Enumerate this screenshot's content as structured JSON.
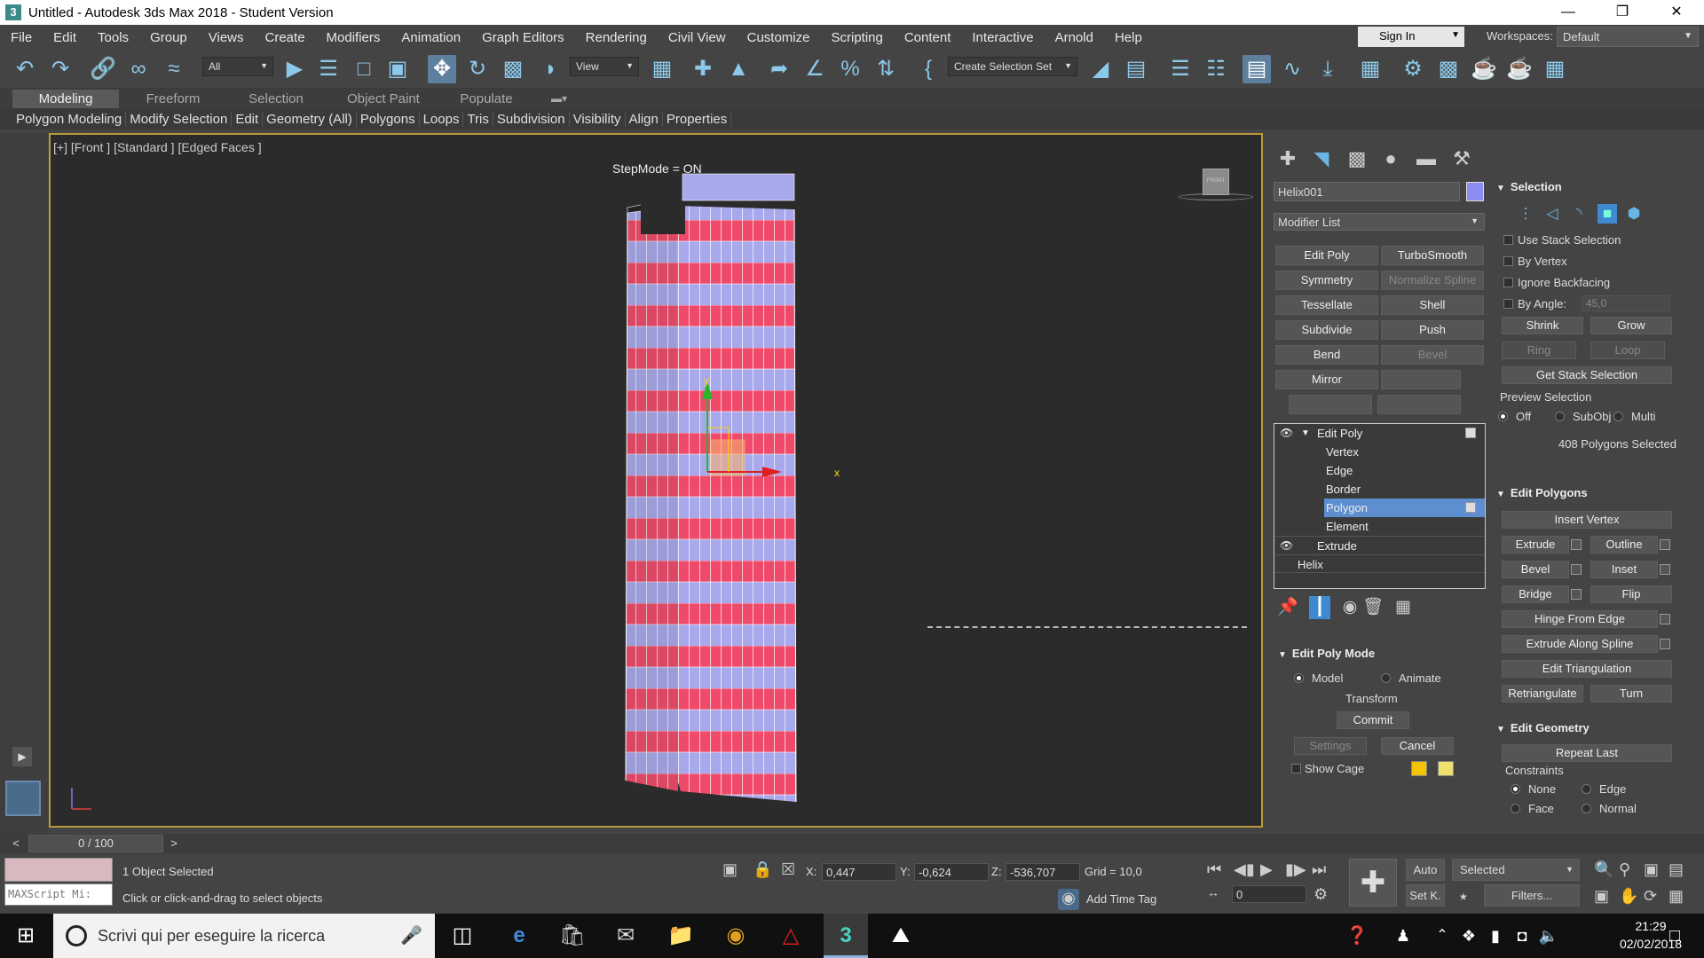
{
  "window": {
    "title": "Untitled - Autodesk 3ds Max 2018 - Student Version",
    "app_icon": "3"
  },
  "menu": [
    "File",
    "Edit",
    "Tools",
    "Group",
    "Views",
    "Create",
    "Modifiers",
    "Animation",
    "Graph Editors",
    "Rendering",
    "Civil View",
    "Customize",
    "Scripting",
    "Content",
    "Interactive",
    "Arnold",
    "Help"
  ],
  "account": {
    "signin": "Sign In",
    "workspaces_label": "Workspaces:",
    "workspace": "Default"
  },
  "toolbar": {
    "filter": "All",
    "refcoord": "View",
    "selection_set": "Create Selection Set"
  },
  "ribbon": {
    "tabs": [
      "Modeling",
      "Freeform",
      "Selection",
      "Object Paint",
      "Populate"
    ],
    "subtabs": [
      "Polygon Modeling",
      "Modify Selection",
      "Edit",
      "Geometry (All)",
      "Polygons",
      "Loops",
      "Tris",
      "Subdivision",
      "Visibility",
      "Align",
      "Properties"
    ]
  },
  "viewport": {
    "label": "[+] [Front ] [Standard ] [Edged Faces ]",
    "stepmode": "StepMode = ON",
    "viewcube": "FRONT",
    "gizmo_x": "x",
    "gizmo_y": "y"
  },
  "command_panel": {
    "object_name": "Helix001",
    "object_color": "#8c8cf0",
    "modifier_list": "Modifier List",
    "modifier_buttons": [
      "Edit Poly",
      "TurboSmooth",
      "Symmetry",
      "Normalize Spline",
      "Tessellate",
      "Shell",
      "Subdivide",
      "Push",
      "Bend",
      "Bevel",
      "Mirror",
      "",
      "",
      ""
    ],
    "stack": {
      "edit_poly": "Edit Poly",
      "sub": [
        "Vertex",
        "Edge",
        "Border",
        "Polygon",
        "Element"
      ],
      "extrude": "Extrude",
      "helix": "Helix"
    },
    "edit_poly_mode": {
      "title": "Edit Poly Mode",
      "model": "Model",
      "animate": "Animate",
      "transform": "Transform",
      "commit": "Commit",
      "settings": "Settings",
      "cancel": "Cancel",
      "show_cage": "Show Cage"
    }
  },
  "selection": {
    "title": "Selection",
    "use_stack": "Use Stack Selection",
    "by_vertex": "By Vertex",
    "ignore_backfacing": "Ignore Backfacing",
    "by_angle": "By Angle:",
    "angle_value": "45,0",
    "shrink": "Shrink",
    "grow": "Grow",
    "ring": "Ring",
    "loop": "Loop",
    "get_stack": "Get Stack Selection",
    "preview": "Preview Selection",
    "off": "Off",
    "subobj": "SubObj",
    "multi": "Multi",
    "count": "408 Polygons Selected"
  },
  "edit_polygons": {
    "title": "Edit Polygons",
    "insert_vertex": "Insert Vertex",
    "extrude": "Extrude",
    "outline": "Outline",
    "bevel": "Bevel",
    "inset": "Inset",
    "bridge": "Bridge",
    "flip": "Flip",
    "hinge": "Hinge From Edge",
    "extrude_spline": "Extrude Along Spline",
    "edit_tri": "Edit Triangulation",
    "retriangulate": "Retriangulate",
    "turn": "Turn"
  },
  "edit_geometry": {
    "title": "Edit Geometry",
    "repeat_last": "Repeat Last",
    "constraints": "Constraints",
    "none": "None",
    "edge": "Edge",
    "face": "Face",
    "normal": "Normal"
  },
  "timeline": {
    "frame": "0 / 100",
    "prev": "<",
    "next": ">"
  },
  "status": {
    "maxscript": "MAXScript Mi:",
    "objects": "1 Object Selected",
    "prompt": "Click or click-and-drag to select objects",
    "x_label": "X:",
    "x": "0,447",
    "y_label": "Y:",
    "y": "-0,624",
    "z_label": "Z:",
    "z": "-536,707",
    "grid": "Grid = 10,0",
    "add_time_tag": "Add Time Tag",
    "auto": "Auto",
    "setk": "Set K.",
    "selected": "Selected",
    "filters": "Filters...",
    "frame_field": "0"
  },
  "taskbar": {
    "search": "Scrivi qui per eseguire la ricerca",
    "time": "21:29",
    "date": "02/02/2018"
  }
}
